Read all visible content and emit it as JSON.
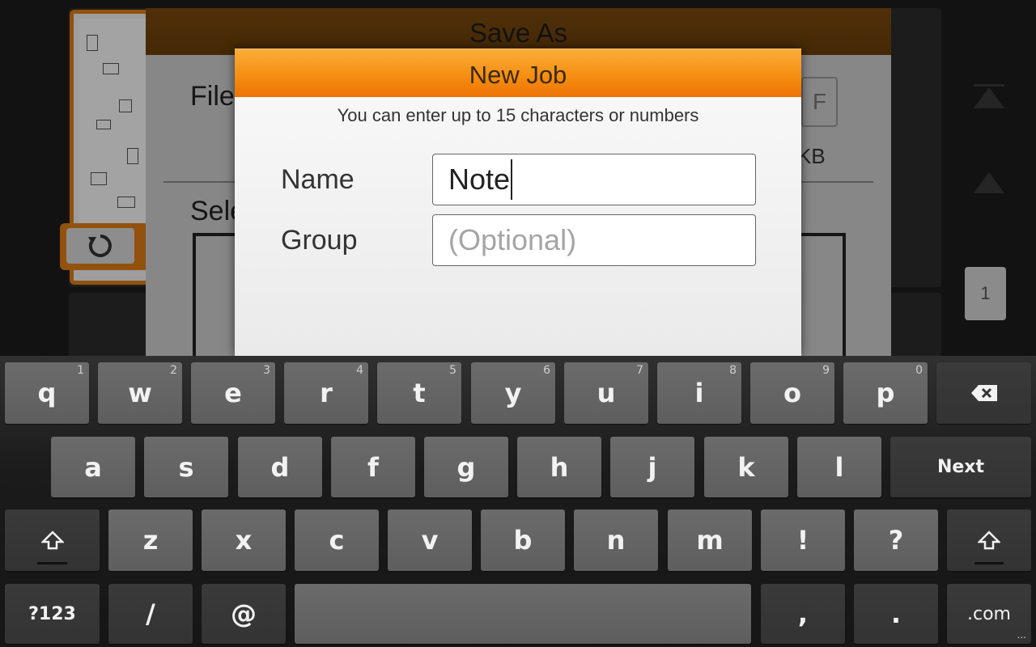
{
  "background": {
    "page_indicator": "1"
  },
  "save_as": {
    "title": "Save As",
    "file_label_partial": "File",
    "select_label_partial": "Sele",
    "format_partial": "F",
    "size_partial": "KB"
  },
  "new_job": {
    "title": "New Job",
    "hint": "You can enter up to 15 characters or numbers",
    "name_label": "Name",
    "name_value": "Note",
    "group_label": "Group",
    "group_placeholder": "(Optional)"
  },
  "keyboard": {
    "row1": [
      {
        "key": "q",
        "hint": "1"
      },
      {
        "key": "w",
        "hint": "2"
      },
      {
        "key": "e",
        "hint": "3"
      },
      {
        "key": "r",
        "hint": "4"
      },
      {
        "key": "t",
        "hint": "5"
      },
      {
        "key": "y",
        "hint": "6"
      },
      {
        "key": "u",
        "hint": "7"
      },
      {
        "key": "i",
        "hint": "8"
      },
      {
        "key": "o",
        "hint": "9"
      },
      {
        "key": "p",
        "hint": "0"
      }
    ],
    "row2": [
      "a",
      "s",
      "d",
      "f",
      "g",
      "h",
      "j",
      "k",
      "l"
    ],
    "row3": [
      "z",
      "x",
      "c",
      "v",
      "b",
      "n",
      "m",
      "!",
      "?"
    ],
    "next_label": "Next",
    "numbers_label": "?123",
    "slash": "/",
    "at": "@",
    "comma": ",",
    "period": ".",
    "dotcom": ".com",
    "corner": "..."
  }
}
